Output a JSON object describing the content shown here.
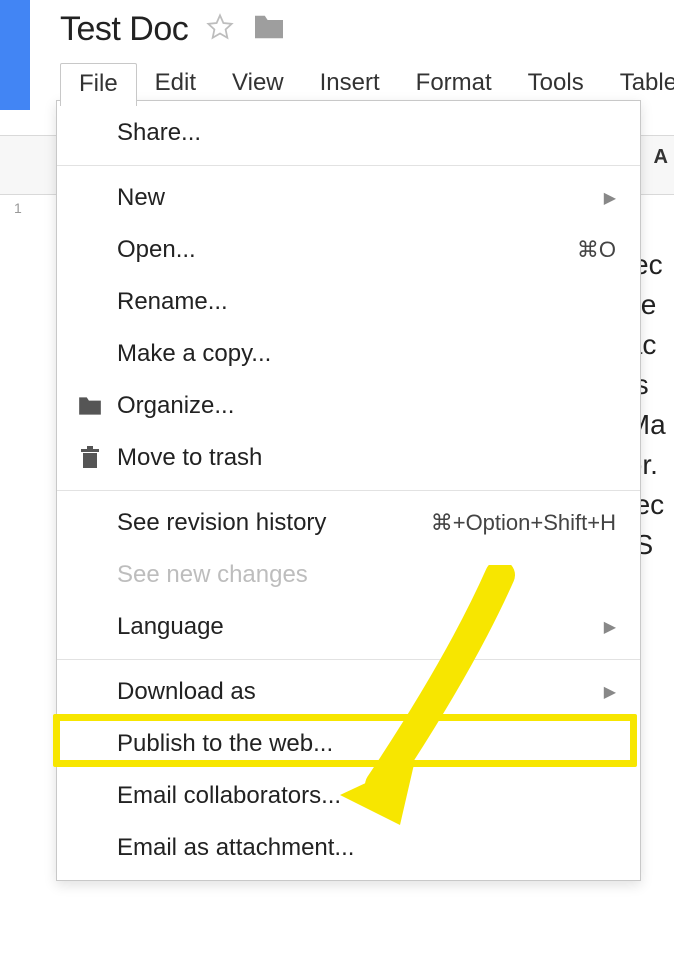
{
  "doc": {
    "title": "Test Doc"
  },
  "menubar": {
    "file": "File",
    "edit": "Edit",
    "view": "View",
    "insert": "Insert",
    "format": "Format",
    "tools": "Tools",
    "table": "Table"
  },
  "menu": {
    "share": "Share...",
    "new": "New",
    "open": "Open...",
    "open_shortcut": "⌘O",
    "rename": "Rename...",
    "make_copy": "Make a copy...",
    "organize": "Organize...",
    "trash": "Move to trash",
    "revision": "See revision history",
    "revision_shortcut": "⌘+Option+Shift+H",
    "new_changes": "See new changes",
    "language": "Language",
    "download": "Download as",
    "publish": "Publish to the web...",
    "email_collab": "Email collaborators...",
    "email_attach": "Email as attachment..."
  },
  "ruler": {
    "one": "1"
  },
  "toolbar": {
    "a": "A"
  },
  "bgtext": "sec\nele\ntac\nus\n Ma\ntor.\nnec\n. S"
}
